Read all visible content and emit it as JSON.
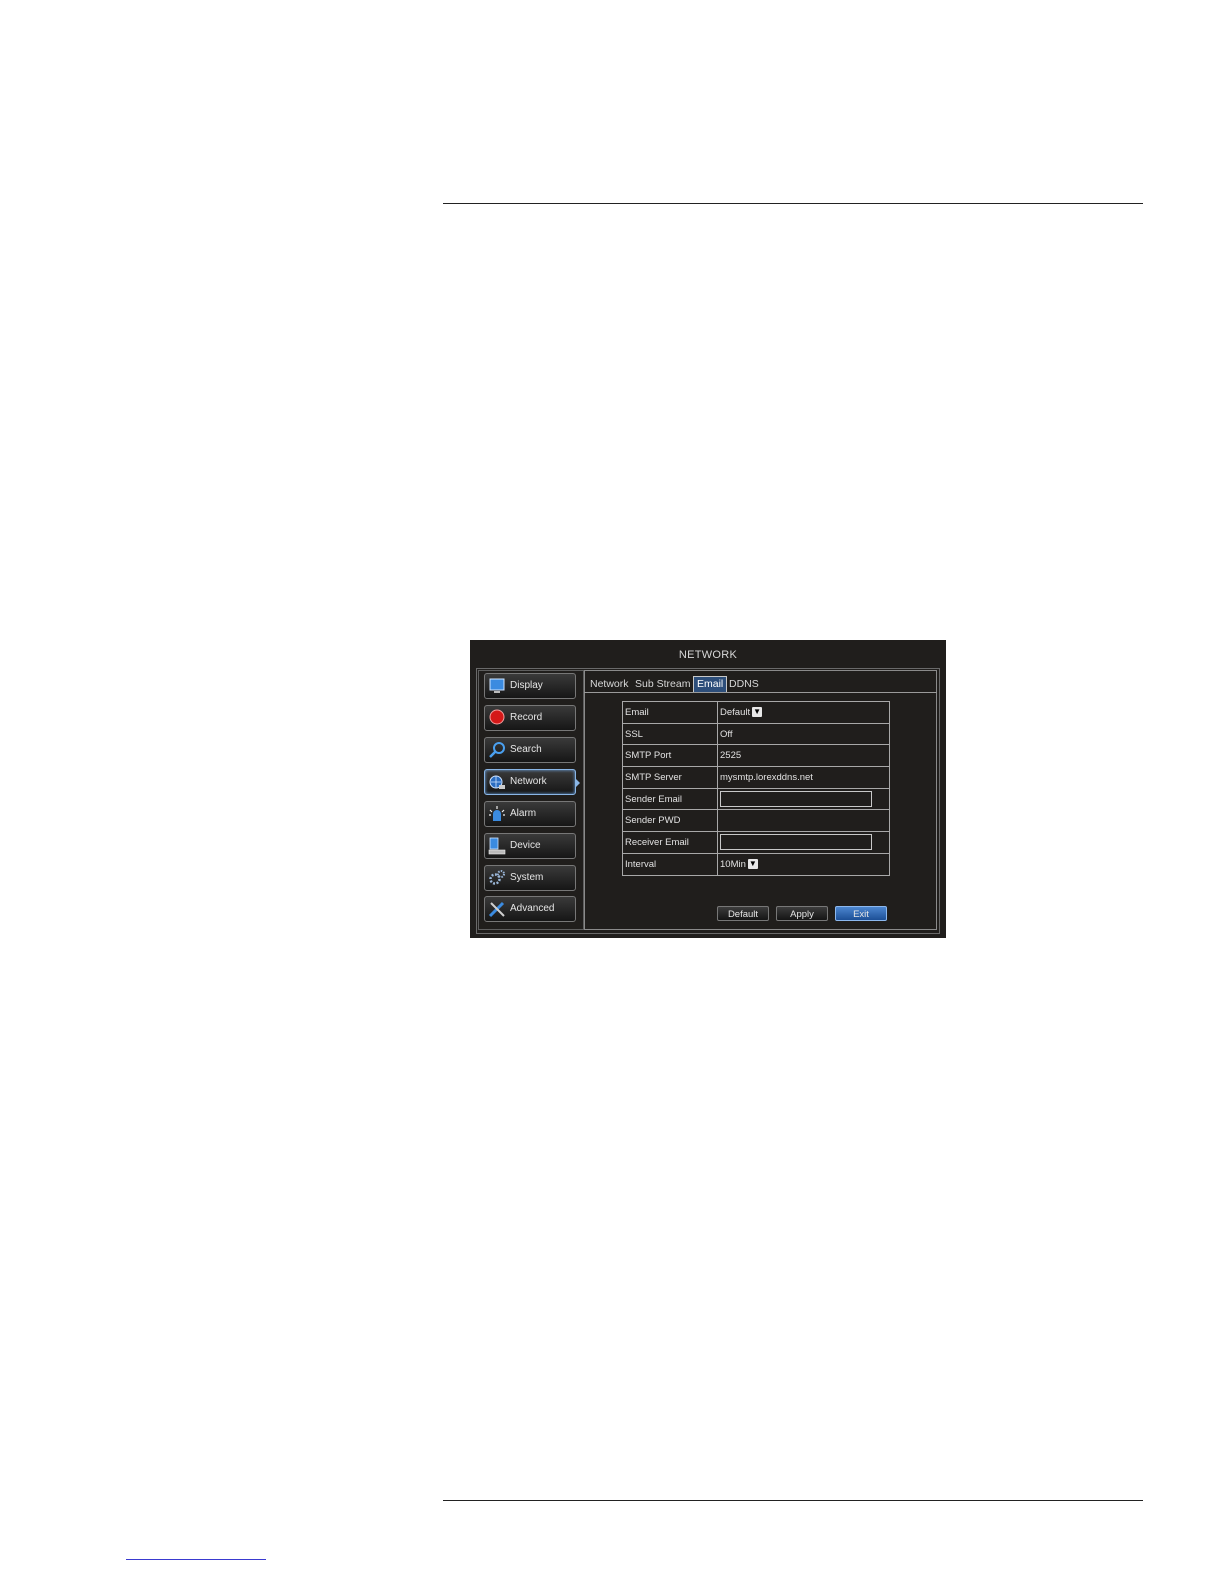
{
  "window": {
    "title": "NETWORK"
  },
  "sidebar": {
    "items": [
      {
        "label": "Display",
        "icon": "monitor-icon"
      },
      {
        "label": "Record",
        "icon": "record-icon"
      },
      {
        "label": "Search",
        "icon": "search-icon"
      },
      {
        "label": "Network",
        "icon": "network-icon",
        "active": true
      },
      {
        "label": "Alarm",
        "icon": "alarm-icon"
      },
      {
        "label": "Device",
        "icon": "device-icon"
      },
      {
        "label": "System",
        "icon": "gear-icon"
      },
      {
        "label": "Advanced",
        "icon": "tools-icon"
      }
    ]
  },
  "tabs": [
    {
      "label": "Network"
    },
    {
      "label": "Sub Stream"
    },
    {
      "label": "Email",
      "active": true
    },
    {
      "label": "DDNS"
    }
  ],
  "email_settings": {
    "rows": [
      {
        "label": "Email",
        "value": "Default",
        "type": "select"
      },
      {
        "label": "SSL",
        "value": "Off",
        "type": "text"
      },
      {
        "label": "SMTP Port",
        "value": "2525",
        "type": "text"
      },
      {
        "label": "SMTP Server",
        "value": "mysmtp.lorexddns.net",
        "type": "text"
      },
      {
        "label": "Sender Email",
        "value": "",
        "type": "input"
      },
      {
        "label": "Sender PWD",
        "value": "",
        "type": "text"
      },
      {
        "label": "Receiver Email",
        "value": "",
        "type": "input"
      },
      {
        "label": "Interval",
        "value": "10Min",
        "type": "select"
      }
    ]
  },
  "buttons": {
    "default": "Default",
    "apply": "Apply",
    "exit": "Exit"
  },
  "colors": {
    "active_tab": "#2d4e7a",
    "exit_button": "#2f6ab8",
    "panel_bg": "#201e1c"
  }
}
